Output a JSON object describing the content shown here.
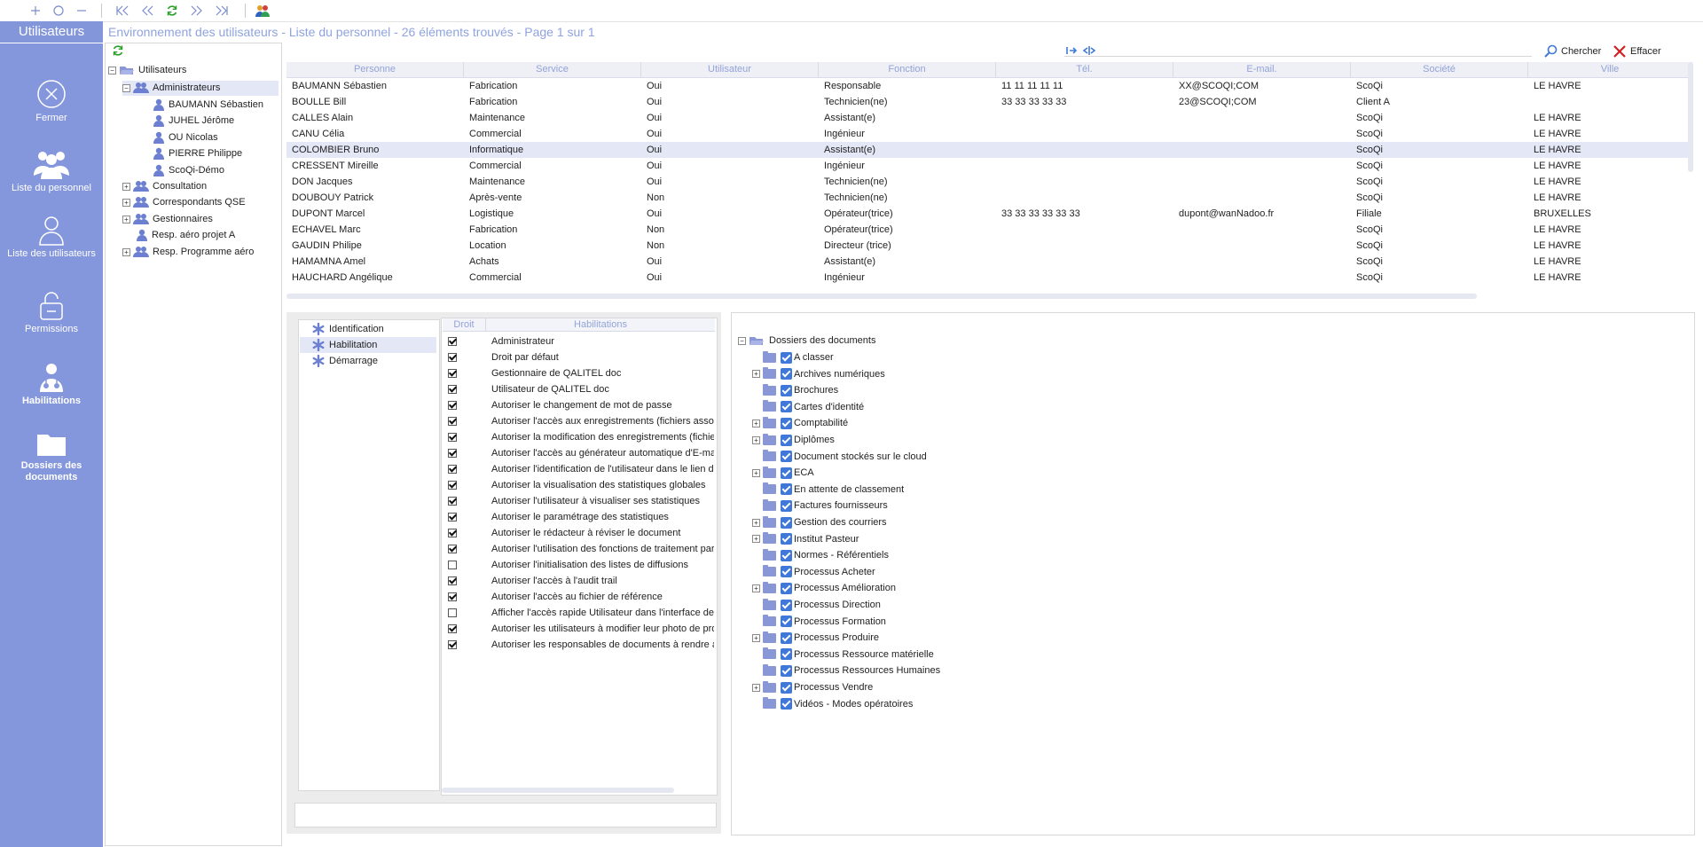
{
  "sidebar": {
    "title": "Utilisateurs",
    "items": [
      {
        "label": "Fermer",
        "icon": "close-circle-icon"
      },
      {
        "label": "Liste du personnel",
        "icon": "people-icon"
      },
      {
        "label": "Liste des utilisateurs",
        "icon": "user-icon"
      },
      {
        "label": "Permissions",
        "icon": "lock-icon"
      },
      {
        "label": "Habilitations",
        "icon": "doctor-icon"
      },
      {
        "label": "Dossiers des documents",
        "icon": "folder-icon"
      }
    ]
  },
  "header": {
    "title": "Environnement des utilisateurs - Liste du personnel - 26 éléments trouvés - Page 1 sur 1"
  },
  "toolbar_right": {
    "search_label": "Chercher",
    "clear_label": "Effacer"
  },
  "tree": {
    "items": [
      {
        "label": "Utilisateurs"
      },
      {
        "label": "Administrateurs"
      },
      {
        "label": "BAUMANN Sébastien"
      },
      {
        "label": "JUHEL Jérôme"
      },
      {
        "label": "OU Nicolas"
      },
      {
        "label": "PIERRE Philippe"
      },
      {
        "label": "ScoQi-Démo"
      },
      {
        "label": "Consultation"
      },
      {
        "label": "Correspondants QSE"
      },
      {
        "label": "Gestionnaires"
      },
      {
        "label": "Resp. aéro projet A"
      },
      {
        "label": "Resp. Programme aéro"
      }
    ]
  },
  "grid": {
    "columns": [
      "Personne",
      "Service",
      "Utilisateur",
      "Fonction",
      "Tél.",
      "E-mail.",
      "Société",
      "Ville"
    ],
    "rows": [
      [
        "BAUMANN Sébastien",
        "Fabrication",
        "Oui",
        "Responsable",
        "11 11 11 11 11",
        "XX@SCOQI;COM",
        "ScoQi",
        "LE HAVRE"
      ],
      [
        "BOULLE Bill",
        "Fabrication",
        "Oui",
        "Technicien(ne)",
        "33 33 33 33 33",
        "23@SCOQI;COM",
        "Client A",
        ""
      ],
      [
        "CALLES Alain",
        "Maintenance",
        "Oui",
        "Assistant(e)",
        "",
        "",
        "ScoQi",
        "LE HAVRE"
      ],
      [
        "CANU Célia",
        "Commercial",
        "Oui",
        "Ingénieur",
        "",
        "",
        "ScoQi",
        "LE HAVRE"
      ],
      [
        "COLOMBIER Bruno",
        "Informatique",
        "Oui",
        "Assistant(e)",
        "",
        "",
        "ScoQi",
        "LE HAVRE"
      ],
      [
        "CRESSENT Mireille",
        "Commercial",
        "Oui",
        "Ingénieur",
        "",
        "",
        "ScoQi",
        "LE HAVRE"
      ],
      [
        "DON Jacques",
        "Maintenance",
        "Oui",
        "Technicien(ne)",
        "",
        "",
        "ScoQi",
        "LE HAVRE"
      ],
      [
        "DOUBOUY Patrick",
        "Après-vente",
        "Non",
        "Technicien(ne)",
        "",
        "",
        "ScoQi",
        "LE HAVRE"
      ],
      [
        "DUPONT Marcel",
        "Logistique",
        "Oui",
        "Opérateur(trice)",
        "33 33 33 33 33 33",
        "dupont@wanNadoo.fr",
        "Filiale",
        "BRUXELLES"
      ],
      [
        "ECHAVEL Marc",
        "Fabrication",
        "Non",
        "Opérateur(trice)",
        "",
        "",
        "ScoQi",
        "LE HAVRE"
      ],
      [
        "GAUDIN Philipe",
        "Location",
        "Non",
        "Directeur (trice)",
        "",
        "",
        "ScoQi",
        "LE HAVRE"
      ],
      [
        "HAMAMNA Amel",
        "Achats",
        "Oui",
        "Assistant(e)",
        "",
        "",
        "ScoQi",
        "LE HAVRE"
      ],
      [
        "HAUCHARD Angélique",
        "Commercial",
        "Oui",
        "Ingénieur",
        "",
        "",
        "ScoQi",
        "LE HAVRE"
      ]
    ]
  },
  "tabs": [
    {
      "label": "Identification"
    },
    {
      "label": "Habilitation"
    },
    {
      "label": "Démarrage"
    }
  ],
  "rights": {
    "col_droit": "Droit",
    "col_hab": "Habilitations",
    "rows": [
      {
        "label": "Administrateur",
        "checked": true
      },
      {
        "label": "Droit par défaut",
        "checked": true
      },
      {
        "label": "Gestionnaire de QALITEL doc",
        "checked": true
      },
      {
        "label": "Utilisateur de QALITEL doc",
        "checked": true
      },
      {
        "label": "Autoriser le changement de mot de passe",
        "checked": true
      },
      {
        "label": "Autoriser l'accès aux enregistrements (fichiers asso",
        "checked": true
      },
      {
        "label": "Autoriser la modification des enregistrements (fichie",
        "checked": true
      },
      {
        "label": "Autoriser l'accès au générateur automatique d'E-mai",
        "checked": true
      },
      {
        "label": "Autoriser l'identification de l'utilisateur dans le lien de",
        "checked": true
      },
      {
        "label": "Autoriser la visualisation des statistiques globales",
        "checked": true
      },
      {
        "label": "Autoriser l'utilisateur à visualiser ses statistiques",
        "checked": true
      },
      {
        "label": "Autoriser le paramétrage des statistiques",
        "checked": true
      },
      {
        "label": "Autoriser le rédacteur à réviser le document",
        "checked": true
      },
      {
        "label": "Autoriser l'utilisation des fonctions de traitement par",
        "checked": true
      },
      {
        "label": "Autoriser l'initialisation des listes de diffusions",
        "checked": false
      },
      {
        "label": "Autoriser l'accès à l'audit trail",
        "checked": true
      },
      {
        "label": "Autoriser l'accès au fichier de référence",
        "checked": true
      },
      {
        "label": "Afficher l'accès rapide Utilisateur dans l'interface de",
        "checked": false
      },
      {
        "label": "Autoriser les utilisateurs à modifier leur photo de pro",
        "checked": true
      },
      {
        "label": "Autoriser les responsables de documents à rendre a",
        "checked": true
      }
    ]
  },
  "documents": {
    "root": "Dossiers des documents",
    "folders": [
      {
        "label": "A classer",
        "expandable": false
      },
      {
        "label": "Archives numériques",
        "expandable": true
      },
      {
        "label": "Brochures",
        "expandable": false
      },
      {
        "label": "Cartes d'identité",
        "expandable": false
      },
      {
        "label": "Comptabilité",
        "expandable": true
      },
      {
        "label": "Diplômes",
        "expandable": true
      },
      {
        "label": "Document stockés sur le cloud",
        "expandable": false
      },
      {
        "label": "ECA",
        "expandable": true
      },
      {
        "label": "En attente de classement",
        "expandable": false
      },
      {
        "label": "Factures fournisseurs",
        "expandable": false
      },
      {
        "label": "Gestion des courriers",
        "expandable": true
      },
      {
        "label": "Institut Pasteur",
        "expandable": true
      },
      {
        "label": "Normes - Référentiels",
        "expandable": false
      },
      {
        "label": "Processus Acheter",
        "expandable": false
      },
      {
        "label": "Processus Amélioration",
        "expandable": true
      },
      {
        "label": "Processus Direction",
        "expandable": false
      },
      {
        "label": "Processus Formation",
        "expandable": false
      },
      {
        "label": "Processus Produire",
        "expandable": true
      },
      {
        "label": "Processus Ressource matérielle",
        "expandable": false
      },
      {
        "label": "Processus Ressources Humaines",
        "expandable": false
      },
      {
        "label": "Processus Vendre",
        "expandable": true
      },
      {
        "label": "Vidéos - Modes opératoires",
        "expandable": false
      }
    ]
  },
  "colors": {
    "sidebar": "#8597dc",
    "accent": "#8fa3e0",
    "selection": "#e3e7f6",
    "checkbox_blue": "#3f78d8"
  }
}
